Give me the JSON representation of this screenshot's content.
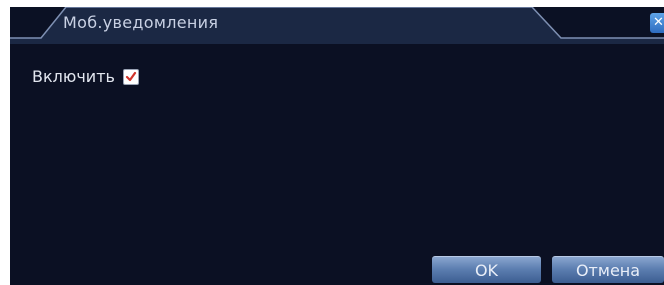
{
  "dialog": {
    "title": "Моб.уведомления",
    "close_symbol": "✕"
  },
  "settings": {
    "enable_label": "Включить",
    "enable_checked": true
  },
  "buttons": {
    "ok_label": "OK",
    "cancel_label": "Отмена"
  },
  "colors": {
    "background": "#0b1124",
    "tab_fill": "#1a2745",
    "button": "#5d7fb1",
    "checkmark": "#d0342c"
  },
  "icons": [
    "close-icon",
    "checkmark-icon"
  ]
}
